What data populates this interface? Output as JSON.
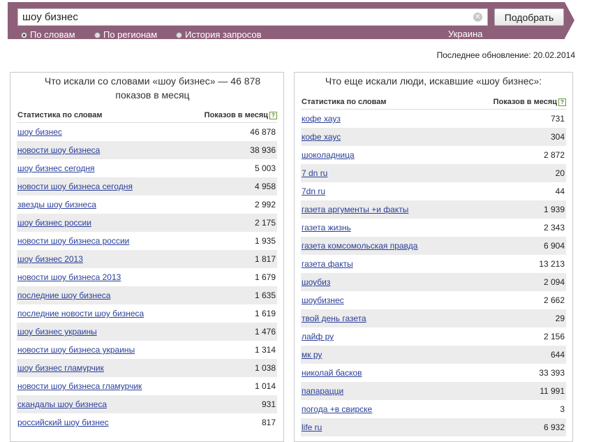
{
  "search": {
    "value": "шоу бизнес",
    "button_label": "Подобрать"
  },
  "modes": [
    {
      "label": "По словам",
      "checked": true
    },
    {
      "label": "По регионам",
      "checked": false
    },
    {
      "label": "История запросов",
      "checked": false
    }
  ],
  "region": "Украина",
  "updated": "Последнее обновление: 20.02.2014",
  "left": {
    "title": "Что искали со словами «шоу бизнес» — 46 878 показов в месяц",
    "col_words": "Статистика по словам",
    "col_shows": "Показов в месяц",
    "rows": [
      {
        "phrase": "шоу бизнес",
        "count": "46 878"
      },
      {
        "phrase": "новости шоу бизнеса",
        "count": "38 936"
      },
      {
        "phrase": "шоу бизнес сегодня",
        "count": "5 003"
      },
      {
        "phrase": "новости шоу бизнеса сегодня",
        "count": "4 958"
      },
      {
        "phrase": "звезды шоу бизнеса",
        "count": "2 992"
      },
      {
        "phrase": "шоу бизнес россии",
        "count": "2 175"
      },
      {
        "phrase": "новости шоу бизнеса россии",
        "count": "1 935"
      },
      {
        "phrase": "шоу бизнес 2013",
        "count": "1 817"
      },
      {
        "phrase": "новости шоу бизнеса 2013",
        "count": "1 679"
      },
      {
        "phrase": "последние шоу бизнеса",
        "count": "1 635"
      },
      {
        "phrase": "последние новости шоу бизнеса",
        "count": "1 619"
      },
      {
        "phrase": "шоу бизнес украины",
        "count": "1 476"
      },
      {
        "phrase": "новости шоу бизнеса украины",
        "count": "1 314"
      },
      {
        "phrase": "шоу бизнес гламурчик",
        "count": "1 038"
      },
      {
        "phrase": "новости шоу бизнеса гламурчик",
        "count": "1 014"
      },
      {
        "phrase": "скандалы шоу бизнеса",
        "count": "931"
      },
      {
        "phrase": "российский шоу бизнес",
        "count": "817"
      }
    ]
  },
  "right": {
    "title": "Что еще искали люди, искавшие «шоу бизнес»:",
    "col_words": "Статистика по словам",
    "col_shows": "Показов в месяц",
    "rows": [
      {
        "phrase": "кофе хауз",
        "count": "731"
      },
      {
        "phrase": "кофе хаус",
        "count": "304"
      },
      {
        "phrase": "шоколадница",
        "count": "2 872"
      },
      {
        "phrase": "7 dn ru",
        "count": "20"
      },
      {
        "phrase": "7dn ru",
        "count": "44"
      },
      {
        "phrase": "газета аргументы +и факты",
        "count": "1 939"
      },
      {
        "phrase": "газета жизнь",
        "count": "2 343"
      },
      {
        "phrase": "газета комсомольская правда",
        "count": "6 904"
      },
      {
        "phrase": "газета факты",
        "count": "13 213"
      },
      {
        "phrase": "шоубиз",
        "count": "2 094"
      },
      {
        "phrase": "шоубизнес",
        "count": "2 662"
      },
      {
        "phrase": "твой день газета",
        "count": "29"
      },
      {
        "phrase": "лайф ру",
        "count": "2 156"
      },
      {
        "phrase": "мк ру",
        "count": "644"
      },
      {
        "phrase": "николай басков",
        "count": "33 393"
      },
      {
        "phrase": "папарацци",
        "count": "11 991"
      },
      {
        "phrase": "погода +в свирске",
        "count": "3"
      },
      {
        "phrase": "life ru",
        "count": "6 932"
      }
    ]
  }
}
